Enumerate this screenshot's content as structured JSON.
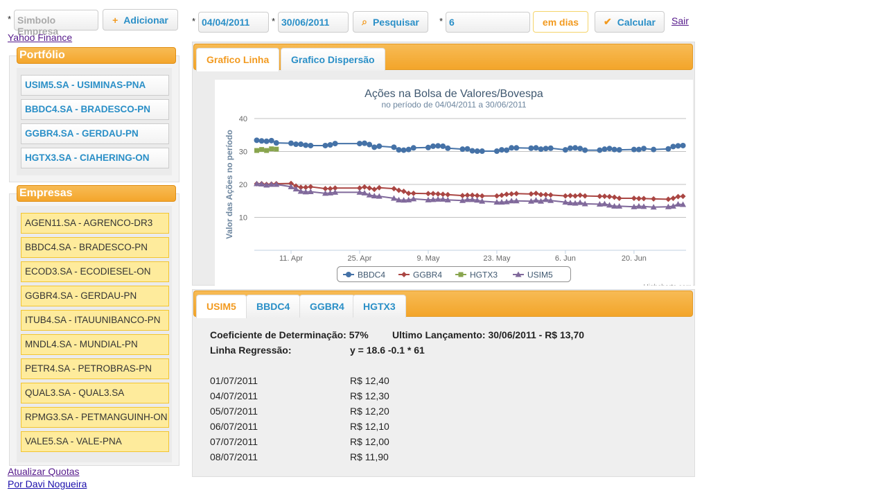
{
  "top": {
    "required_mark": "*",
    "symbol_placeholder": "Simbolo Empresa",
    "add_label": "Adicionar",
    "start_date": "04/04/2011",
    "end_date": "30/06/2011",
    "search_label": "Pesquisar",
    "days_value": "6",
    "days_unit": "em dias",
    "calc_label": "Calcular",
    "exit_link": "Sair",
    "yahoo_link": "Yahoo Finance"
  },
  "portfolio": {
    "title": "Portfólio",
    "items": [
      "USIM5.SA - USIMINAS-PNA",
      "BBDC4.SA - BRADESCO-PN",
      "GGBR4.SA - GERDAU-PN",
      "HGTX3.SA - CIAHERING-ON"
    ]
  },
  "companies": {
    "title": "Empresas",
    "items": [
      "AGEN11.SA - AGRENCO-DR3",
      "BBDC4.SA - BRADESCO-PN",
      "ECOD3.SA - ECODIESEL-ON",
      "GGBR4.SA - GERDAU-PN",
      "ITUB4.SA - ITAUUNIBANCO-PN",
      "MNDL4.SA - MUNDIAL-PN",
      "PETR4.SA - PETROBRAS-PN",
      "QUAL3.SA - QUAL3.SA",
      "RPMG3.SA - PETMANGUINH-ON",
      "VALE5.SA - VALE-PNA"
    ]
  },
  "footer": {
    "update_link": "Atualizar Quotas",
    "author_link": "Por Davi Nogueira"
  },
  "chart_tabs": [
    "Grafico Linha",
    "Grafico Dispersão"
  ],
  "chart_data": {
    "type": "line",
    "title": "Ações na Bolsa de Valores/Bovespa",
    "subtitle": "no período de 04/04/2011 a 30/06/2011",
    "ylabel": "Valor das Ações no período",
    "xlabel": "",
    "ylim": [
      0,
      40
    ],
    "yticks": [
      10,
      20,
      30,
      40
    ],
    "xticks": [
      {
        "date": "2011-04-11",
        "label": "11. Apr"
      },
      {
        "date": "2011-04-25",
        "label": "25. Apr"
      },
      {
        "date": "2011-05-09",
        "label": "9. May"
      },
      {
        "date": "2011-05-23",
        "label": "23. May"
      },
      {
        "date": "2011-06-06",
        "label": "6. Jun"
      },
      {
        "date": "2011-06-20",
        "label": "20. Jun"
      }
    ],
    "grid": true,
    "legend": "bottom",
    "credit": "Highcharts.com",
    "x": [
      "2011-04-04",
      "2011-04-05",
      "2011-04-06",
      "2011-04-07",
      "2011-04-08",
      "2011-04-11",
      "2011-04-12",
      "2011-04-13",
      "2011-04-14",
      "2011-04-15",
      "2011-04-18",
      "2011-04-19",
      "2011-04-20",
      "2011-04-25",
      "2011-04-26",
      "2011-04-27",
      "2011-04-28",
      "2011-04-29",
      "2011-05-02",
      "2011-05-03",
      "2011-05-04",
      "2011-05-05",
      "2011-05-06",
      "2011-05-09",
      "2011-05-10",
      "2011-05-11",
      "2011-05-12",
      "2011-05-13",
      "2011-05-16",
      "2011-05-17",
      "2011-05-18",
      "2011-05-19",
      "2011-05-20",
      "2011-05-23",
      "2011-05-24",
      "2011-05-25",
      "2011-05-26",
      "2011-05-27",
      "2011-05-30",
      "2011-05-31",
      "2011-06-01",
      "2011-06-02",
      "2011-06-03",
      "2011-06-06",
      "2011-06-07",
      "2011-06-08",
      "2011-06-09",
      "2011-06-10",
      "2011-06-13",
      "2011-06-14",
      "2011-06-15",
      "2011-06-16",
      "2011-06-17",
      "2011-06-20",
      "2011-06-21",
      "2011-06-22",
      "2011-06-24",
      "2011-06-27",
      "2011-06-28",
      "2011-06-29",
      "2011-06-30"
    ],
    "series": [
      {
        "name": "BBDC4",
        "color": "#4572a7",
        "marker": "circle",
        "values": [
          33.4,
          33.2,
          33.1,
          33.3,
          32.6,
          32.5,
          32.2,
          32.2,
          31.9,
          31.8,
          31.8,
          32.0,
          32.4,
          32.4,
          32.5,
          32.1,
          31.3,
          31.6,
          31.3,
          30.5,
          30.4,
          30.6,
          31.1,
          31.2,
          31.6,
          31.7,
          31.6,
          31.0,
          30.7,
          30.8,
          30.2,
          30.1,
          30.1,
          30.1,
          30.5,
          30.4,
          31.1,
          31.1,
          31.0,
          31.1,
          30.7,
          30.9,
          31.0,
          30.5,
          31.0,
          31.1,
          30.9,
          30.4,
          30.4,
          30.7,
          30.9,
          30.6,
          30.5,
          30.6,
          30.6,
          30.9,
          30.6,
          30.8,
          31.5,
          31.7,
          31.8
        ]
      },
      {
        "name": "GGBR4",
        "color": "#aa4643",
        "marker": "diamond",
        "values": [
          20.2,
          20.2,
          20.0,
          20.1,
          20.2,
          20.3,
          19.5,
          19.1,
          19.1,
          19.3,
          18.7,
          18.7,
          18.9,
          18.9,
          19.2,
          18.9,
          18.5,
          19.0,
          18.7,
          18.2,
          17.9,
          17.3,
          17.3,
          17.2,
          17.2,
          17.1,
          17.0,
          16.9,
          16.6,
          16.7,
          16.7,
          16.6,
          16.5,
          16.5,
          16.7,
          17.0,
          17.1,
          17.2,
          17.1,
          17.3,
          16.9,
          16.9,
          16.8,
          16.5,
          16.6,
          16.5,
          16.7,
          16.5,
          16.4,
          16.4,
          16.3,
          16.1,
          15.8,
          15.8,
          15.7,
          15.7,
          15.6,
          15.5,
          15.8,
          16.3,
          16.4
        ]
      },
      {
        "name": "HGTX3",
        "color": "#89a54e",
        "marker": "square",
        "values": [
          30.3,
          30.6,
          30.3,
          30.8,
          30.7
        ]
      },
      {
        "name": "USIM5",
        "color": "#80699b",
        "marker": "triangle",
        "values": [
          20.2,
          20.1,
          19.8,
          20.0,
          20.0,
          19.3,
          18.6,
          17.9,
          17.7,
          17.8,
          17.3,
          17.4,
          17.6,
          17.6,
          17.4,
          16.8,
          16.5,
          16.4,
          15.8,
          15.3,
          15.2,
          15.3,
          15.6,
          15.3,
          15.4,
          15.5,
          15.5,
          15.3,
          15.1,
          15.4,
          15.4,
          15.2,
          14.9,
          14.6,
          14.6,
          14.7,
          15.0,
          15.0,
          14.9,
          15.2,
          14.9,
          15.4,
          15.1,
          14.6,
          14.4,
          14.3,
          14.5,
          14.1,
          14.0,
          14.1,
          13.7,
          13.4,
          13.4,
          13.2,
          13.4,
          13.3,
          13.1,
          13.2,
          13.4,
          14.0,
          13.9
        ]
      }
    ]
  },
  "stock_tabs": [
    "USIM5",
    "BBDC4",
    "GGBR4",
    "HGTX3"
  ],
  "stats": {
    "coef_label": "Coeficiente de Determinação: 57%",
    "last_label": "Ultimo Lançamento: 30/06/2011 - R$ 13,70",
    "regression_label": "Linha Regressão:",
    "regression_value": "y = 18.6 -0.1 * 61",
    "forecast": [
      {
        "date": "01/07/2011",
        "value": "R$ 12,40"
      },
      {
        "date": "04/07/2011",
        "value": "R$ 12,30"
      },
      {
        "date": "05/07/2011",
        "value": "R$ 12,20"
      },
      {
        "date": "06/07/2011",
        "value": "R$ 12,10"
      },
      {
        "date": "07/07/2011",
        "value": "R$ 12,00"
      },
      {
        "date": "08/07/2011",
        "value": "R$ 11,90"
      }
    ]
  }
}
